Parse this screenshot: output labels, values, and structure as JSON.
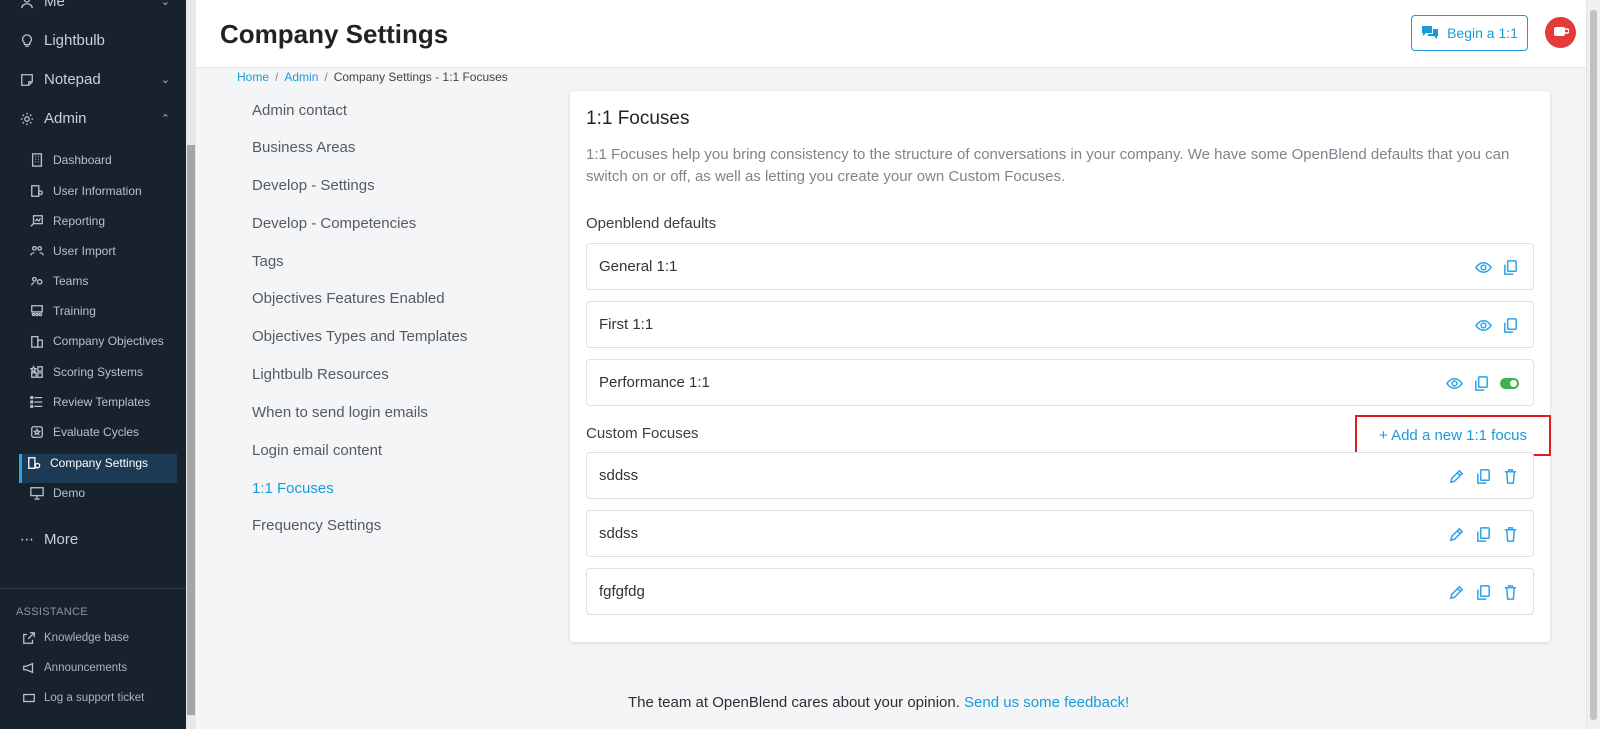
{
  "sidebar": {
    "top_items": [
      {
        "label": "Me",
        "icon": "person-icon"
      },
      {
        "label": "Lightbulb",
        "icon": "lightbulb-icon"
      },
      {
        "label": "Notepad",
        "icon": "notepad-icon"
      },
      {
        "label": "Admin",
        "icon": "gear-icon"
      }
    ],
    "admin_items": [
      {
        "label": "Dashboard"
      },
      {
        "label": "User Information"
      },
      {
        "label": "Reporting"
      },
      {
        "label": "User Import"
      },
      {
        "label": "Teams"
      },
      {
        "label": "Training"
      },
      {
        "label": "Company Objectives"
      },
      {
        "label": "Scoring Systems"
      },
      {
        "label": "Review Templates"
      },
      {
        "label": "Evaluate Cycles"
      },
      {
        "label": "Company Settings",
        "active": true
      },
      {
        "label": "Demo"
      }
    ],
    "more_label": "More",
    "assistance_heading": "ASSISTANCE",
    "assistance_items": [
      {
        "label": "Knowledge base"
      },
      {
        "label": "Announcements"
      },
      {
        "label": "Log a support ticket"
      }
    ]
  },
  "header": {
    "title": "Company Settings",
    "begin_button": "Begin a 1:1"
  },
  "breadcrumb": {
    "home": "Home",
    "admin": "Admin",
    "current": "Company Settings - 1:1 Focuses"
  },
  "settings_nav": [
    "Admin contact",
    "Business Areas",
    "Develop - Settings",
    "Develop - Competencies",
    "Tags",
    "Objectives Features Enabled",
    "Objectives Types and Templates",
    "Lightbulb Resources",
    "When to send login emails",
    "Login email content",
    "1:1 Focuses",
    "Frequency Settings"
  ],
  "settings_nav_active": "1:1 Focuses",
  "focuses": {
    "title": "1:1 Focuses",
    "description": "1:1 Focuses help you bring consistency to the structure of conversations in your company. We have some OpenBlend defaults that you can switch on or off, as well as letting you create your own Custom Focuses.",
    "defaults_label": "Openblend defaults",
    "defaults": [
      {
        "name": "General 1:1",
        "toggle": false
      },
      {
        "name": "First 1:1",
        "toggle": false
      },
      {
        "name": "Performance 1:1",
        "toggle": true
      }
    ],
    "custom_label": "Custom Focuses",
    "add_button": "+ Add a new 1:1 focus",
    "custom": [
      {
        "name": "sddss"
      },
      {
        "name": "sddss"
      },
      {
        "name": "fgfgfdg"
      }
    ]
  },
  "footer": {
    "text": "The team at OpenBlend cares about your opinion.",
    "link": "Send us some feedback!"
  },
  "colors": {
    "accent": "#1a9bd7",
    "sidebar_bg": "#17222d",
    "toggle_on": "#3cb44b",
    "highlight_border": "#e11d1d"
  }
}
